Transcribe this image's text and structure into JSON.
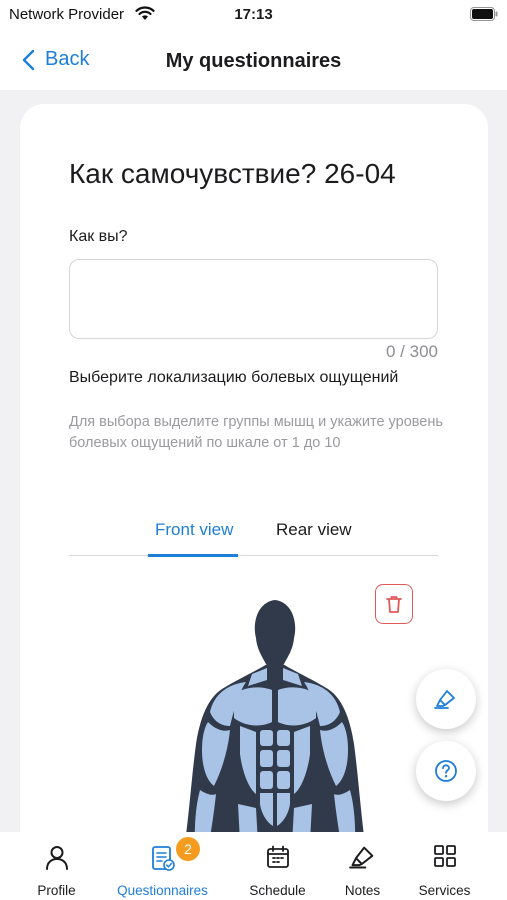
{
  "status_bar": {
    "carrier": "Network Provider",
    "time": "17:13",
    "icons": [
      "wifi-icon",
      "battery-icon"
    ]
  },
  "nav": {
    "back_label": "Back",
    "title": "My questionnaires"
  },
  "form": {
    "title": "Как самочувствие? 26-04",
    "question_label": "Как вы?",
    "answer_value": "",
    "char_counter": "0 / 300",
    "pain_label": "Выберите локализацию болевых ощущений",
    "hint": "Для выбора выделите группы мышц и укажите уровень болевых ощущений по шкале от 1 до 10",
    "tabs": [
      {
        "label": "Front view",
        "active": true
      },
      {
        "label": "Rear view",
        "active": false
      }
    ]
  },
  "body_map": {
    "view": "front",
    "head_color": "#303a4a",
    "muscle_color": "#a8c3e6",
    "icons": [
      "trash-icon"
    ]
  },
  "fabs": [
    "highlighter-icon",
    "question-icon"
  ],
  "tabbar": {
    "items": [
      {
        "label": "Profile",
        "icon": "person-icon",
        "active": false
      },
      {
        "label": "Questionnaires",
        "icon": "questionnaire-icon",
        "active": true,
        "badge": "2"
      },
      {
        "label": "Schedule",
        "icon": "calendar-icon",
        "active": false
      },
      {
        "label": "Notes",
        "icon": "highlighter-icon",
        "active": false
      },
      {
        "label": "Services",
        "icon": "grid-icon",
        "active": false
      }
    ]
  },
  "colors": {
    "accent": "#1f7ed9",
    "danger": "#e15a5a",
    "badge": "#f39c20"
  }
}
